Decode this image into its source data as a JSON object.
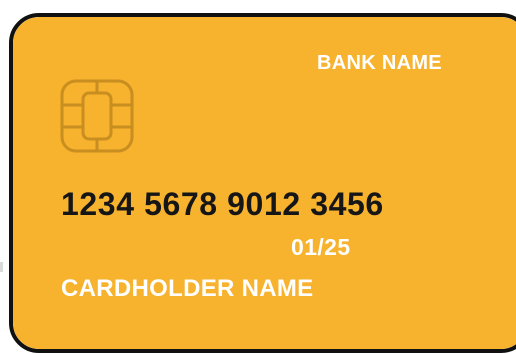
{
  "card": {
    "bank_name": "BANK NAME",
    "card_number": "1234 5678 9012 3456",
    "expiry": "01/25",
    "cardholder_name": "CARDHOLDER NAME",
    "chip_icon": "sim-chip-icon"
  },
  "colors": {
    "card_background": "#F7B22E",
    "border": "#111111",
    "light_text": "#FFFFFF",
    "dark_text": "#161616",
    "chip_stroke": "#C88E20"
  }
}
